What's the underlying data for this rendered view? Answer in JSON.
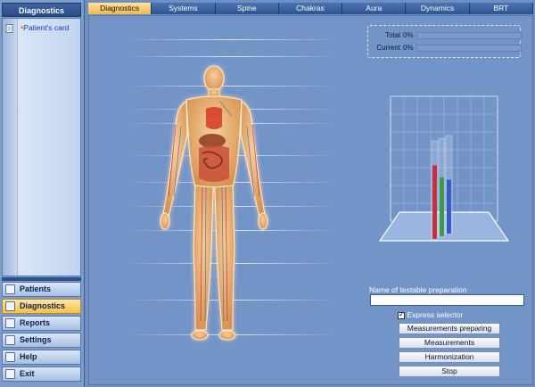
{
  "left_panel": {
    "title": "Diagnostics",
    "tree": {
      "item_label": "Patient's card"
    },
    "nav": [
      {
        "label": "Patients",
        "icon": "patients-icon"
      },
      {
        "label": "Diagnostics",
        "icon": "diagnostics-icon",
        "active": true
      },
      {
        "label": "Reports",
        "icon": "reports-icon"
      },
      {
        "label": "Settings",
        "icon": "settings-icon"
      },
      {
        "label": "Help",
        "icon": "help-icon"
      },
      {
        "label": "Exit",
        "icon": "exit-icon"
      }
    ]
  },
  "tabs": [
    "Diagnostics",
    "Systems",
    "Spine",
    "Chakras",
    "Aura",
    "Dynamics",
    "BRT"
  ],
  "active_tab": "Diagnostics",
  "progress": {
    "total_label": "Total",
    "total_value": "0%",
    "total_fraction": 0,
    "current_label": "Current",
    "current_value": "0%",
    "current_fraction": 0
  },
  "chart_data": {
    "type": "bar",
    "series": [
      {
        "color": "#c63040",
        "level": 0.75
      },
      {
        "color": "#3a9a4a",
        "level": 0.6
      },
      {
        "color": "#3a5ac8",
        "level": 0.55
      }
    ]
  },
  "preparation": {
    "label": "Name of testable preparation",
    "value": "",
    "express_label": "Express selector",
    "express_checked": true
  },
  "actions": {
    "measurements_preparing": "Measurements preparing",
    "measurements": "Measurements",
    "harmonization": "Harmonization",
    "stop": "Stop"
  },
  "colors": {
    "accent": "#f0b64a",
    "panel": "#7394c7"
  }
}
